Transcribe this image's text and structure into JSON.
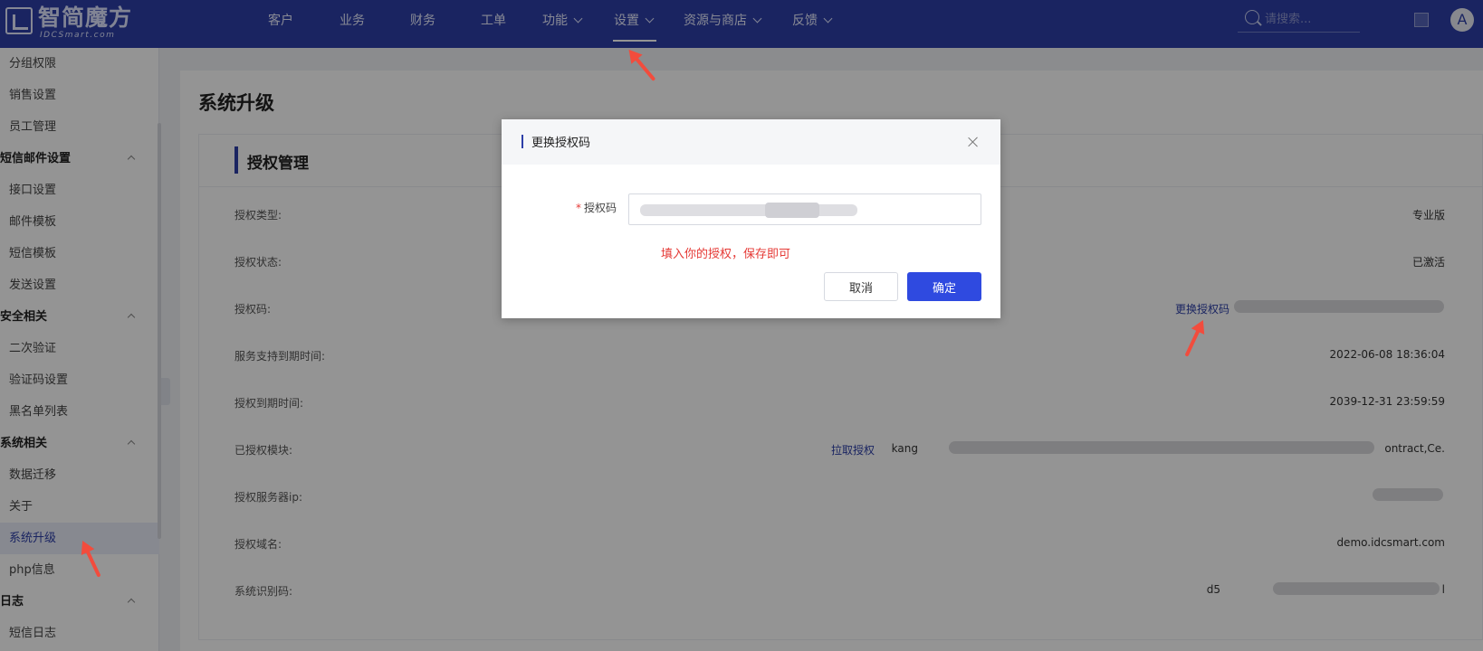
{
  "brand": {
    "name": "智简魔方",
    "sub": "IDCSmart.com"
  },
  "nav": {
    "items": [
      {
        "label": "客户"
      },
      {
        "label": "业务"
      },
      {
        "label": "财务"
      },
      {
        "label": "工单"
      },
      {
        "label": "功能"
      },
      {
        "label": "设置"
      },
      {
        "label": "资源与商店"
      },
      {
        "label": "反馈"
      }
    ],
    "active": "设置",
    "search_placeholder": "请搜索...",
    "avatar_letter": "A"
  },
  "sidebar": {
    "items": [
      {
        "label": "分组权限",
        "type": "sub"
      },
      {
        "label": "销售设置",
        "type": "sub"
      },
      {
        "label": "员工管理",
        "type": "sub"
      },
      {
        "label": "短信邮件设置",
        "type": "group"
      },
      {
        "label": "接口设置",
        "type": "sub"
      },
      {
        "label": "邮件模板",
        "type": "sub"
      },
      {
        "label": "短信模板",
        "type": "sub"
      },
      {
        "label": "发送设置",
        "type": "sub"
      },
      {
        "label": "安全相关",
        "type": "group"
      },
      {
        "label": "二次验证",
        "type": "sub"
      },
      {
        "label": "验证码设置",
        "type": "sub"
      },
      {
        "label": "黑名单列表",
        "type": "sub"
      },
      {
        "label": "系统相关",
        "type": "group"
      },
      {
        "label": "数据迁移",
        "type": "sub"
      },
      {
        "label": "关于",
        "type": "sub"
      },
      {
        "label": "系统升级",
        "type": "sub",
        "active": true
      },
      {
        "label": "php信息",
        "type": "sub"
      },
      {
        "label": "日志",
        "type": "group"
      },
      {
        "label": "短信日志",
        "type": "sub"
      }
    ]
  },
  "page": {
    "title": "系统升级",
    "panel_title": "授权管理",
    "rows": [
      {
        "label": "授权类型:",
        "value": "专业版"
      },
      {
        "label": "授权状态:",
        "value": "已激活"
      },
      {
        "label": "授权码:",
        "link": "更换授权码",
        "value": ""
      },
      {
        "label": "服务支持到期时间:",
        "value": "2022-06-08 18:36:04"
      },
      {
        "label": "授权到期时间:",
        "value": "2039-12-31 23:59:59"
      },
      {
        "label": "已授权模块:",
        "link": "拉取授权",
        "value": "kang",
        "value_tail": "ontract,Ce."
      },
      {
        "label": "授权服务器ip:",
        "value": ""
      },
      {
        "label": "授权域名:",
        "value": "demo.idcsmart.com"
      },
      {
        "label": "系统识别码:",
        "value": "d5",
        "value_tail": "l"
      }
    ]
  },
  "modal": {
    "title": "更换授权码",
    "field_label": "授权码",
    "required_mark": "*",
    "hint": "填入你的授权，保存即可",
    "cancel_label": "取消",
    "confirm_label": "确定"
  },
  "colors": {
    "topbar": "#2d3fa8",
    "primary_button": "#2f4ae0",
    "hint": "#e53935",
    "annotation_arrow": "#f24c3d"
  }
}
